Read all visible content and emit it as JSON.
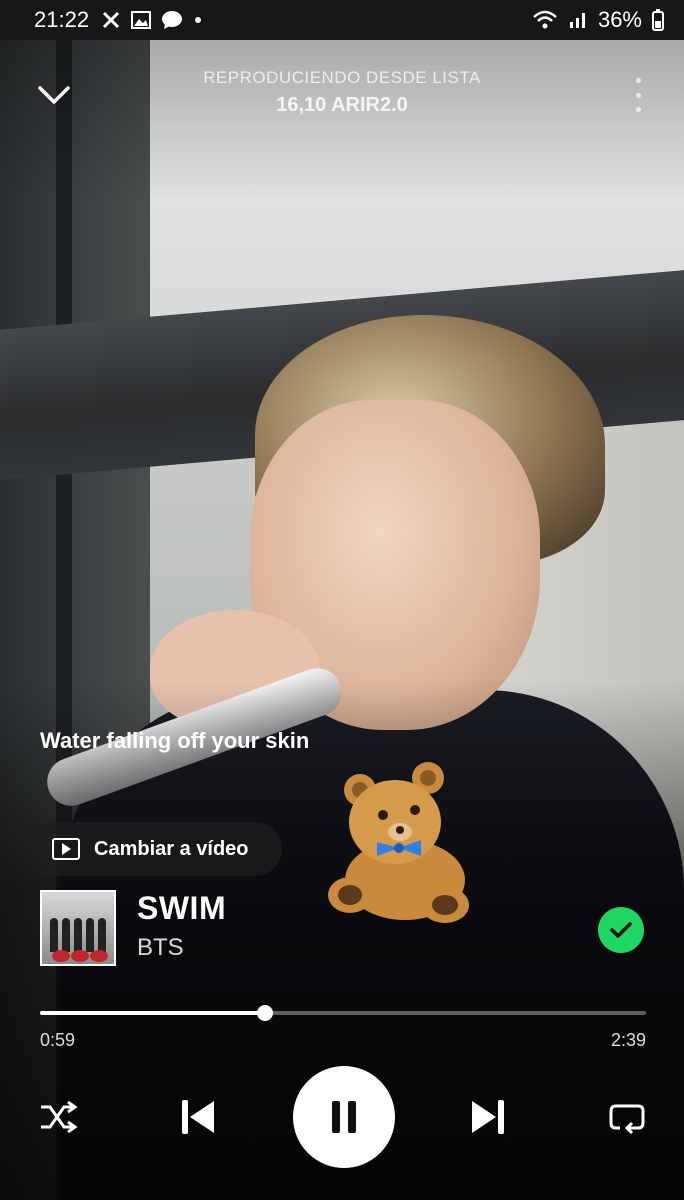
{
  "status_bar": {
    "time": "21:22",
    "battery": "36%"
  },
  "header": {
    "kicker": "REPRODUCIENDO DESDE LISTA",
    "playlist": "16,10 ARIR2.0"
  },
  "lyric": "Water falling off your skin",
  "video_button": {
    "label": "Cambiar a vídeo"
  },
  "track": {
    "title": "SWIM",
    "artist": "BTS",
    "saved": true
  },
  "playback": {
    "elapsed": "0:59",
    "duration": "2:39",
    "progress": 0.3711
  },
  "colors": {
    "accent": "#1ed760"
  },
  "icons": [
    "chevron-down-icon",
    "more-options-icon",
    "video-icon",
    "check-icon",
    "shuffle-icon",
    "previous-icon",
    "pause-icon",
    "next-icon",
    "repeat-icon"
  ]
}
